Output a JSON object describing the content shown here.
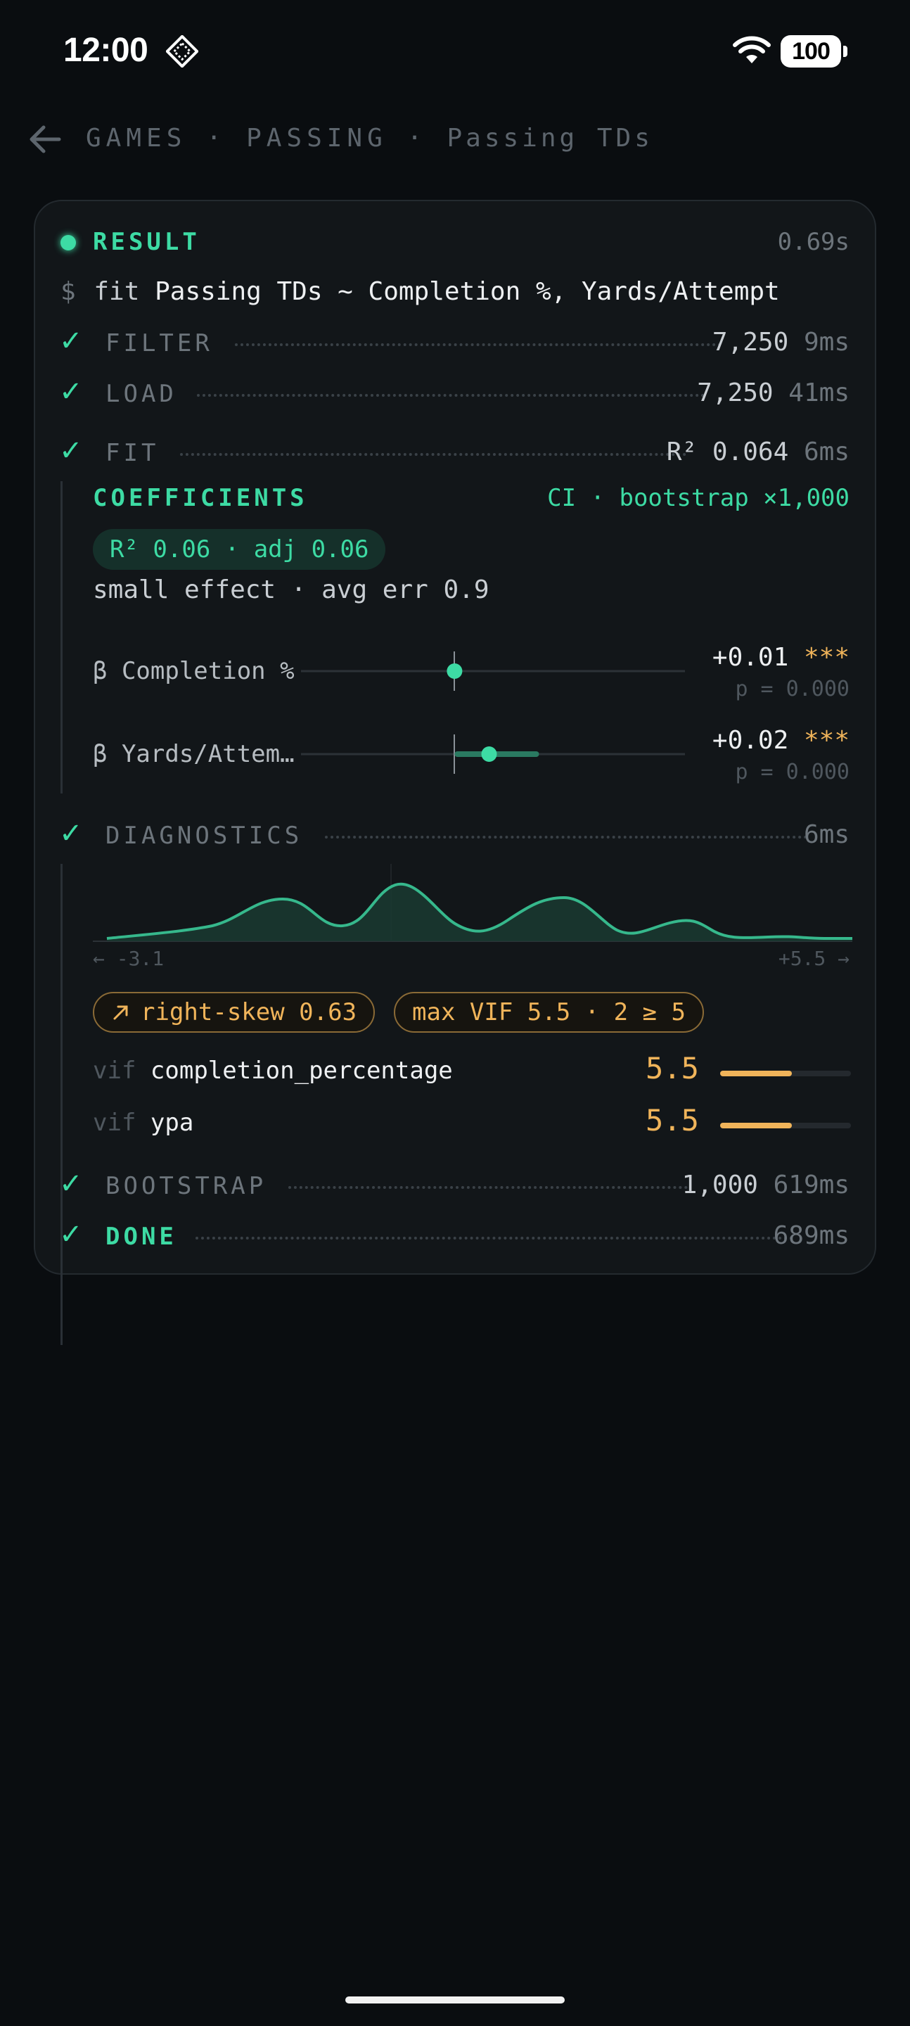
{
  "status_bar": {
    "time": "12:00",
    "battery": "100"
  },
  "breadcrumb": {
    "items": [
      "GAMES",
      "PASSING",
      "Passing TDs"
    ],
    "separator": "·"
  },
  "result": {
    "label": "RESULT",
    "duration": "0.69s",
    "prompt": "$",
    "command_keyword": "fit",
    "command_formula": "Passing TDs ~ Completion %, Yards/Attempt"
  },
  "steps": {
    "filter": {
      "label": "FILTER",
      "value": "7,250",
      "time": "9ms"
    },
    "load": {
      "label": "LOAD",
      "value": "7,250",
      "time": "41ms"
    },
    "fit": {
      "label": "FIT",
      "value": "R² 0.064",
      "time": "6ms"
    },
    "diagnostics": {
      "label": "DIAGNOSTICS",
      "time": "6ms"
    },
    "bootstrap": {
      "label": "BOOTSTRAP",
      "value": "1,000",
      "time": "619ms"
    },
    "done": {
      "label": "DONE",
      "time": "689ms"
    }
  },
  "coefficients": {
    "heading": "COEFFICIENTS",
    "ci_label": "CI · bootstrap ×1,000",
    "r2_chip": "R² 0.06 · adj 0.06",
    "summary": "small effect · avg err 0.9",
    "rows": [
      {
        "label": "β Completion %",
        "estimate": "+0.01",
        "stars": "***",
        "p": "p = 0.000",
        "position": 0.4,
        "ci_low": 0.39,
        "ci_high": 0.41
      },
      {
        "label": "β Yards/Attem…",
        "estimate": "+0.02",
        "stars": "***",
        "p": "p = 0.000",
        "position": 0.49,
        "ci_low": 0.4,
        "ci_high": 0.62
      }
    ]
  },
  "diagnostics": {
    "axis_min": "← -3.1",
    "axis_max": "+5.5 →",
    "skew_chip": "right-skew 0.63",
    "skew_icon": "arrow-up-right-icon",
    "vif_chip": "max VIF 5.5 · 2 ≥ 5",
    "vif_prefix": "vif",
    "vif_rows": [
      {
        "name": "completion_percentage",
        "value": "5.5",
        "fill": 0.55
      },
      {
        "name": "ypa",
        "value": "5.5",
        "fill": 0.55
      }
    ]
  },
  "colors": {
    "accent": "#3ddba4",
    "warning": "#f0b45a",
    "background": "#0a0d10",
    "card": "#121619"
  }
}
